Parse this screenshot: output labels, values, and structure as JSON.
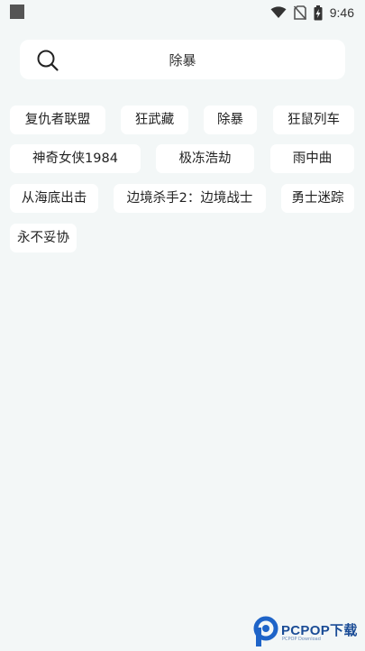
{
  "status_bar": {
    "time": "9:46",
    "icons": [
      "wifi-icon",
      "no-sim-icon",
      "battery-charging-icon"
    ]
  },
  "search": {
    "query": "除暴",
    "icon": "search-icon"
  },
  "history_tags": [
    "复仇者联盟",
    "狂武藏",
    "除暴",
    "狂鼠列车",
    "神奇女侠1984",
    "极冻浩劫",
    "雨中曲",
    "从海底出击",
    "边境杀手2：边境战士",
    "勇士迷踪",
    "永不妥协"
  ],
  "watermark": {
    "brand": "PCPOP下载",
    "sub": "PCPOP Download"
  }
}
